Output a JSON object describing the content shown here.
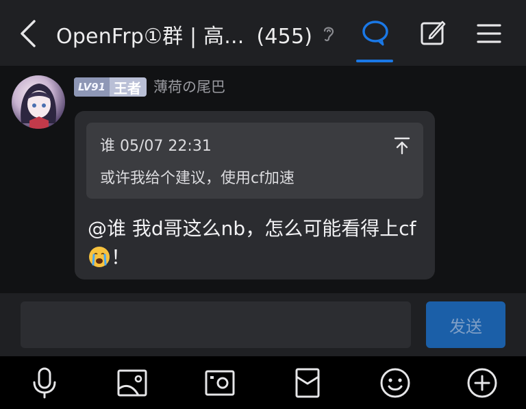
{
  "header": {
    "title": "OpenFrp①群 | 高...",
    "member_count": "(455)",
    "icons": {
      "back": "chevron-left-icon",
      "ear": "ear-icon",
      "chat": "chat-bubble-icon",
      "edit": "edit-icon",
      "menu": "menu-icon"
    },
    "accent_color": "#1a78e6"
  },
  "message": {
    "sender": {
      "level": "LV91",
      "rank": "王者",
      "nickname": "薄荷の尾巴"
    },
    "quote": {
      "author": "谁",
      "timestamp": "05/07 22:31",
      "text": "或许我给个建议，使用cf加速"
    },
    "text_main": "@谁 我d哥这么nb，怎么可能看得上cf",
    "emoji": "crying-face",
    "text_tail": "！"
  },
  "composer": {
    "input_value": "",
    "send_label": "发送",
    "send_color": "#1b5fa8"
  },
  "toolbar": {
    "icons": [
      "microphone-icon",
      "image-icon",
      "camera-icon",
      "red-packet-icon",
      "emoji-icon",
      "plus-icon"
    ]
  }
}
